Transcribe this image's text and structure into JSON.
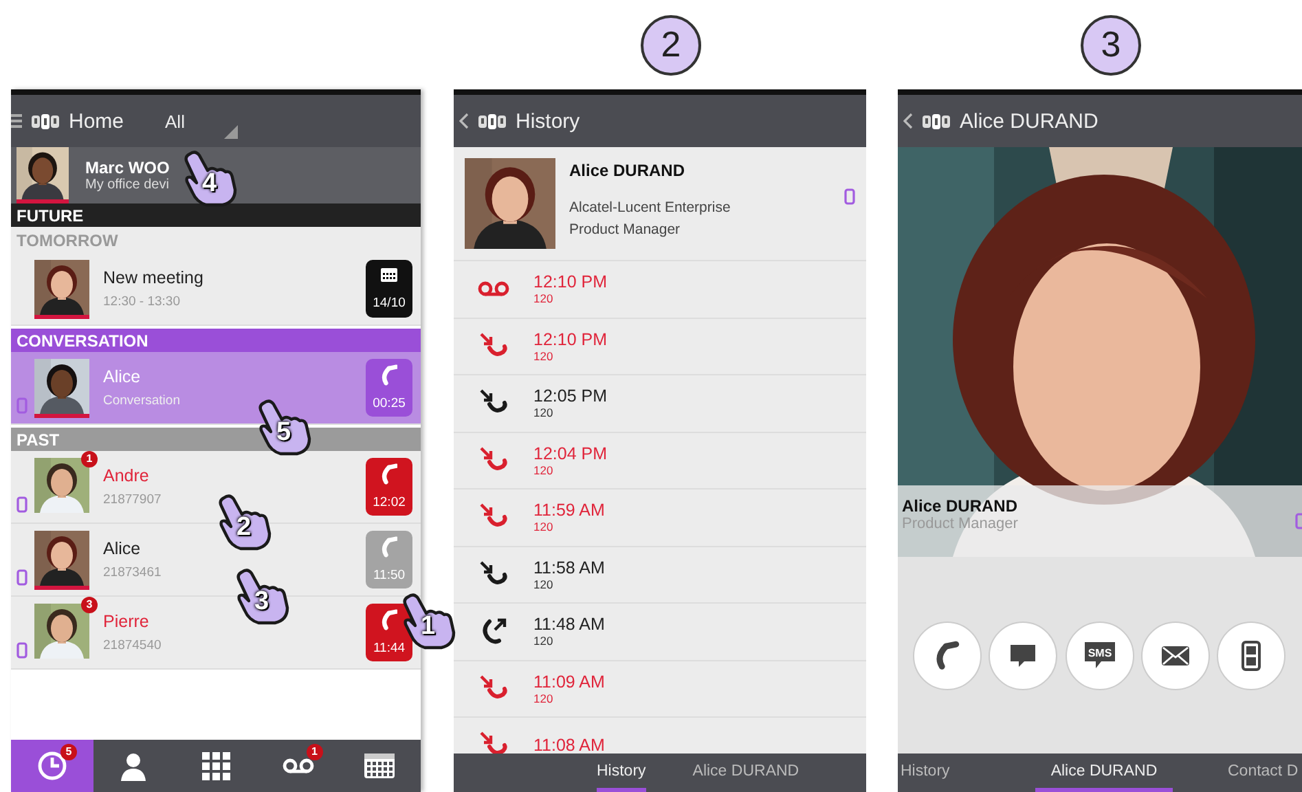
{
  "screens": [
    {
      "kind": "home",
      "header": {
        "title": "Home",
        "filter": "All"
      },
      "profile": {
        "name": "Marc WOO",
        "device": "My office devi",
        "busy": true,
        "hand_marker": "4"
      },
      "sections": [
        {
          "kind": "future",
          "title": "FUTURE",
          "subtitle": "TOMORROW",
          "rows": [
            {
              "name": "New meeting",
              "detail": "12:30 - 13:30",
              "missed": false,
              "busy": true,
              "mobile": false,
              "badge": {
                "kind": "meeting",
                "text": "14/10"
              }
            }
          ]
        },
        {
          "kind": "conversation",
          "title": "CONVERSATION",
          "rows": [
            {
              "name": "Alice",
              "detail": "Conversation",
              "missed": false,
              "busy": true,
              "mobile": true,
              "badge": {
                "kind": "active",
                "text": "00:25"
              },
              "hand_marker": "5"
            }
          ]
        },
        {
          "kind": "past",
          "title": "PAST",
          "rows": [
            {
              "name": "Andre",
              "detail": "21877907",
              "missed": true,
              "busy": false,
              "mobile": true,
              "unread": "1",
              "badge": {
                "kind": "missed",
                "text": "12:02"
              },
              "hand_marker": "2"
            },
            {
              "name": "Alice",
              "detail": "21873461",
              "missed": false,
              "busy": true,
              "mobile": true,
              "badge": {
                "kind": "answered",
                "text": "11:50"
              },
              "hand_marker": "3"
            },
            {
              "name": "Pierre",
              "detail": "21874540",
              "missed": true,
              "busy": false,
              "mobile": true,
              "unread": "3",
              "badge": {
                "kind": "missed",
                "text": "11:44",
                "hand_marker": "1"
              }
            }
          ]
        }
      ],
      "nav": [
        {
          "kind": "clock",
          "selected": true,
          "count": "5"
        },
        {
          "kind": "person",
          "selected": false
        },
        {
          "kind": "dialpad",
          "selected": false
        },
        {
          "kind": "voicemail",
          "selected": false,
          "count": "1"
        },
        {
          "kind": "calendar",
          "selected": false
        }
      ]
    },
    {
      "kind": "history",
      "step": "2",
      "header": {
        "title": "History"
      },
      "contact": {
        "name": "Alice DURAND",
        "company": "Alcatel-Lucent Enterprise",
        "role": "Product Manager"
      },
      "calls": [
        {
          "kind": "voicemail",
          "missed": true,
          "time": "12:10 PM",
          "number": "120"
        },
        {
          "kind": "incoming",
          "missed": true,
          "time": "12:10 PM",
          "number": "120"
        },
        {
          "kind": "incoming",
          "missed": false,
          "time": "12:05 PM",
          "number": "120"
        },
        {
          "kind": "incoming",
          "missed": true,
          "time": "12:04 PM",
          "number": "120"
        },
        {
          "kind": "incoming",
          "missed": true,
          "time": "11:59 AM",
          "number": "120"
        },
        {
          "kind": "incoming",
          "missed": false,
          "time": "11:58 AM",
          "number": "120"
        },
        {
          "kind": "outgoing",
          "missed": false,
          "time": "11:48 AM",
          "number": "120"
        },
        {
          "kind": "incoming",
          "missed": true,
          "time": "11:09 AM",
          "number": "120"
        },
        {
          "kind": "incoming",
          "missed": true,
          "time": "11:08 AM"
        }
      ],
      "tabs": [
        {
          "label": "History",
          "selected": true
        },
        {
          "label": "Alice DURAND",
          "selected": false
        }
      ]
    },
    {
      "kind": "contact",
      "step": "3",
      "header": {
        "title": "Alice DURAND"
      },
      "name": "Alice DURAND",
      "role": "Product Manager",
      "actions": [
        {
          "kind": "call"
        },
        {
          "kind": "chat"
        },
        {
          "kind": "sms",
          "label": "SMS"
        },
        {
          "kind": "email"
        },
        {
          "kind": "mobile"
        }
      ],
      "tabs": [
        {
          "label": "History",
          "selected": false
        },
        {
          "label": "Alice DURAND",
          "selected": true
        },
        {
          "label": "Contact D",
          "selected": false
        }
      ]
    }
  ]
}
